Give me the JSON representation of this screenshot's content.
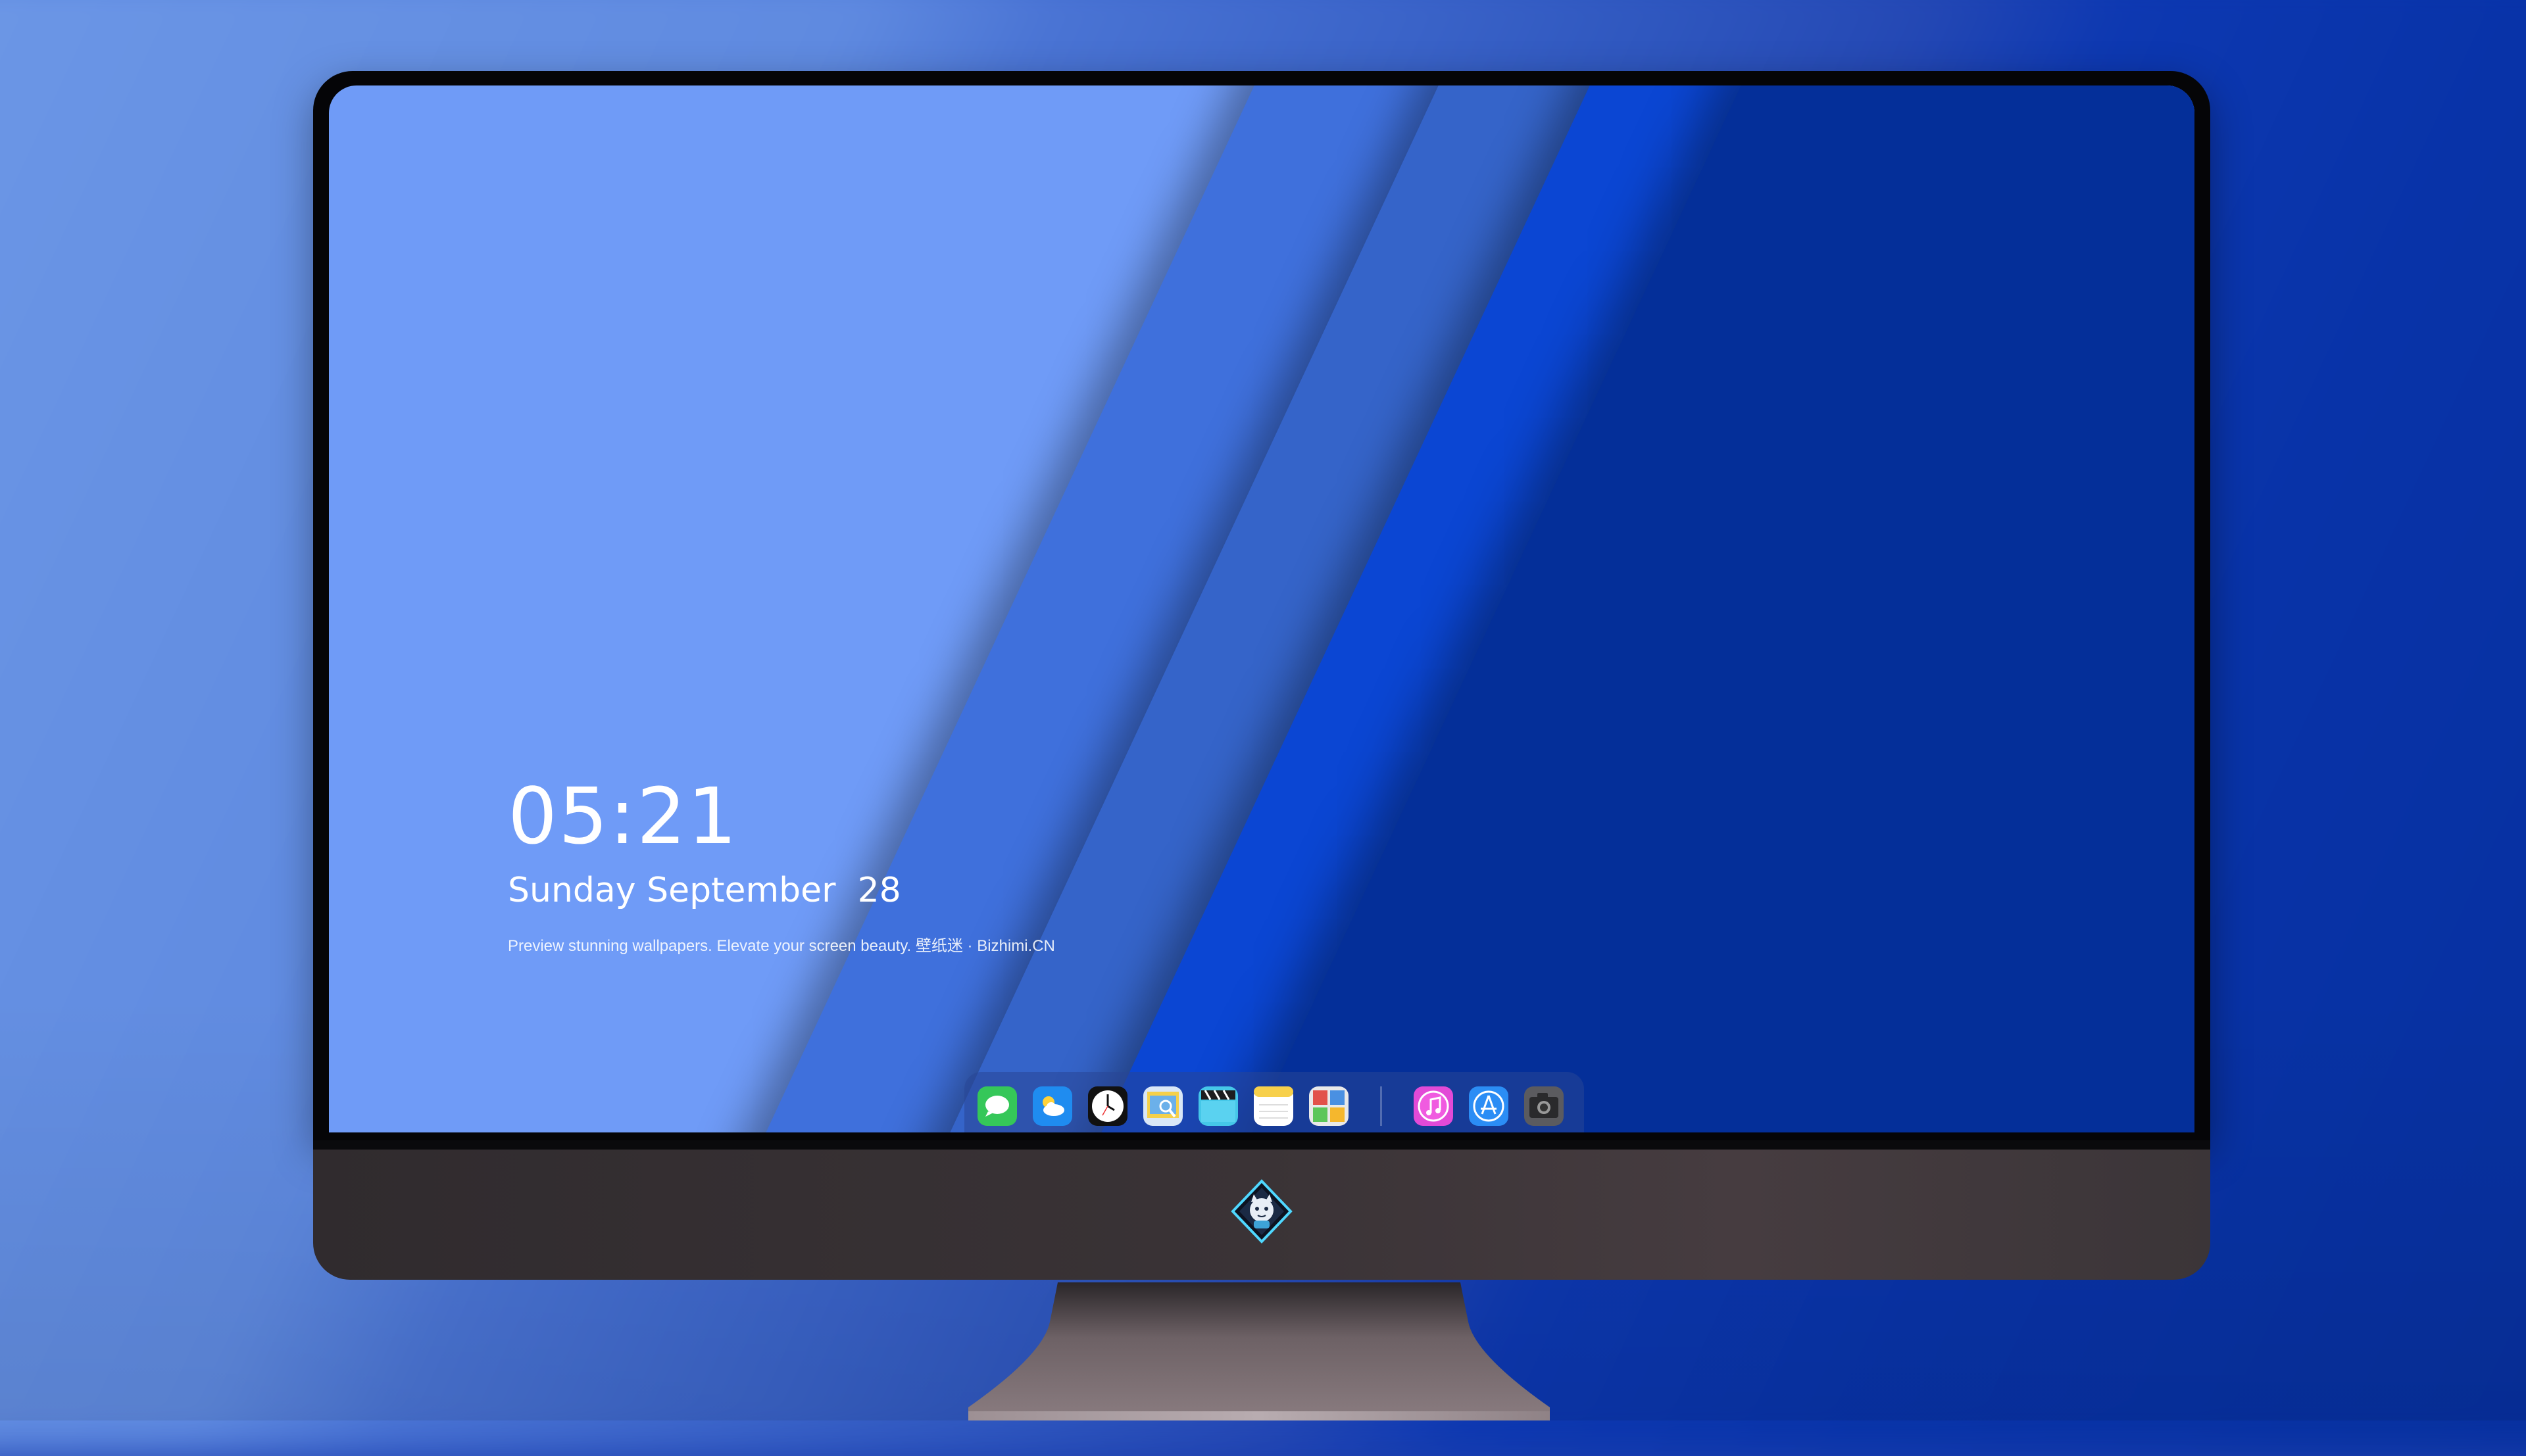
{
  "lock_screen": {
    "time": "05:21",
    "date": "Sunday September  28",
    "tagline": "Preview stunning wallpapers. Elevate your screen beauty. 壁纸迷 · Bizhimi.CN"
  },
  "dock": {
    "apps": [
      {
        "name": "messages-icon",
        "color": "#35c759"
      },
      {
        "name": "weather-icon",
        "color": "#1f8cf0"
      },
      {
        "name": "clock-icon",
        "color": "#111111"
      },
      {
        "name": "preview-icon",
        "color": "#f5d04a"
      },
      {
        "name": "clips-icon",
        "color": "#45c7e8"
      },
      {
        "name": "notes-icon",
        "color": "#f7d04b"
      },
      {
        "name": "photo-booth-icon",
        "color": "#e9e9e9"
      },
      {
        "name": "music-icon",
        "color": "#e24ad7"
      },
      {
        "name": "app-store-icon",
        "color": "#2b8df5"
      },
      {
        "name": "camera-icon",
        "color": "#5b5b5f"
      }
    ]
  },
  "colors": {
    "wallpaper_light": "#6f9bf7",
    "wallpaper_mid": "#3564c9",
    "wallpaper_deep": "#042f99",
    "bezel": "#050507",
    "chin": "#3a3336"
  }
}
